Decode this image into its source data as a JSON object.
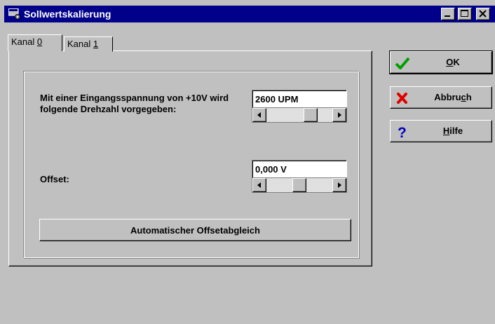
{
  "window": {
    "title": "Sollwertskalierung",
    "title_icon": "app-window-icon",
    "controls": [
      "minimize-icon",
      "maximize-icon",
      "close-icon"
    ]
  },
  "tabs": [
    {
      "label_pre": "Kanal ",
      "label_key": "0"
    },
    {
      "label_pre": "Kanal ",
      "label_key": "1"
    }
  ],
  "active_tab": 0,
  "rpm": {
    "label": "Mit einer Eingangsspannung von +10V wird folgende Drehzahl vorgegeben:",
    "value": "2600 UPM",
    "slider_fraction": 0.72
  },
  "offset": {
    "label": "Offset:",
    "value": "0,000 V",
    "slider_fraction": 0.5
  },
  "auto_offset_button": "Automatischer Offsetabgleich",
  "buttons": {
    "ok": {
      "pre": "",
      "key": "O",
      "post": "K",
      "icon": "checkmark-icon"
    },
    "cancel": {
      "pre": "Abbru",
      "key": "c",
      "post": "h",
      "icon": "red-x-icon"
    },
    "help": {
      "pre": "",
      "key": "H",
      "post": "ilfe",
      "icon": "question-mark-icon"
    }
  },
  "colors": {
    "titlebar": "#00008b",
    "face": "#c0c0c0",
    "ok_icon": "#00a000",
    "cancel_icon": "#e00000",
    "help_icon": "#0000c0"
  }
}
